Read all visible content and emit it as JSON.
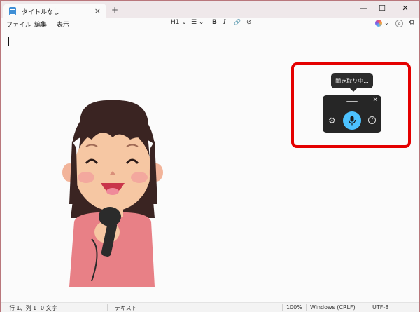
{
  "tab": {
    "title": "タイトルなし",
    "close": "×",
    "new": "+"
  },
  "window_controls": {
    "minimize": "—",
    "maximize": "☐",
    "close": "✕"
  },
  "menu": [
    "ファイル",
    "編集",
    "表示"
  ],
  "toolbar": {
    "heading": "H1 ⌄",
    "list": "☰ ⌄",
    "bold": "B",
    "italic": "I",
    "link": "🔗",
    "clear": "⊘",
    "copilot_chevron": "⌄",
    "account": "a",
    "settings": "⚙"
  },
  "voice": {
    "tooltip": "聞き取り中...",
    "close": "✕",
    "gear": "⚙",
    "help": "?"
  },
  "status": {
    "position": "行 1、列 1",
    "chars": "0 文字",
    "format": "テキスト",
    "zoom": "100%",
    "line_ending": "Windows (CRLF)",
    "encoding": "UTF-8"
  },
  "colors": {
    "accent": "#4cc2ff",
    "highlight": "#e40000"
  }
}
